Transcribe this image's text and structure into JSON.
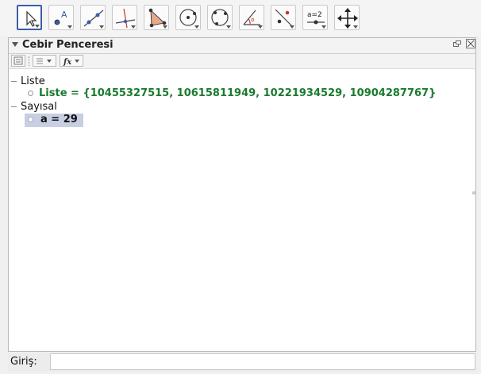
{
  "toolbar": {
    "tools": [
      {
        "icon": "move-arrow-icon",
        "selected": true
      },
      {
        "icon": "point-icon",
        "selected": false
      },
      {
        "icon": "line-icon",
        "selected": false
      },
      {
        "icon": "perpendicular-line-icon",
        "selected": false
      },
      {
        "icon": "polygon-icon",
        "selected": false
      },
      {
        "icon": "circle-with-center-icon",
        "selected": false
      },
      {
        "icon": "circle-through-points-icon",
        "selected": false
      },
      {
        "icon": "angle-icon",
        "selected": false
      },
      {
        "icon": "reflect-about-line-icon",
        "selected": false
      },
      {
        "icon": "slider-icon",
        "label": "a=2",
        "selected": false
      },
      {
        "icon": "move-graphics-view-icon",
        "selected": false
      }
    ]
  },
  "algebra_view": {
    "title": "Cebir Penceresi",
    "categories": [
      {
        "label": "Liste",
        "items": [
          {
            "text": "Liste = {10455327515, 10615811949, 10221934529, 10904287767}",
            "color": "#1a7a2e",
            "selected": false
          }
        ]
      },
      {
        "label": "Sayısal",
        "items": [
          {
            "text": "a = 29",
            "color": "#111111",
            "selected": true
          }
        ]
      }
    ]
  },
  "input_bar": {
    "label": "Giriş:",
    "value": ""
  },
  "colors": {
    "selected_tool_border": "#3a5da8",
    "list_text": "#1a7a2e",
    "selection_bg": "#c8cfe2"
  }
}
